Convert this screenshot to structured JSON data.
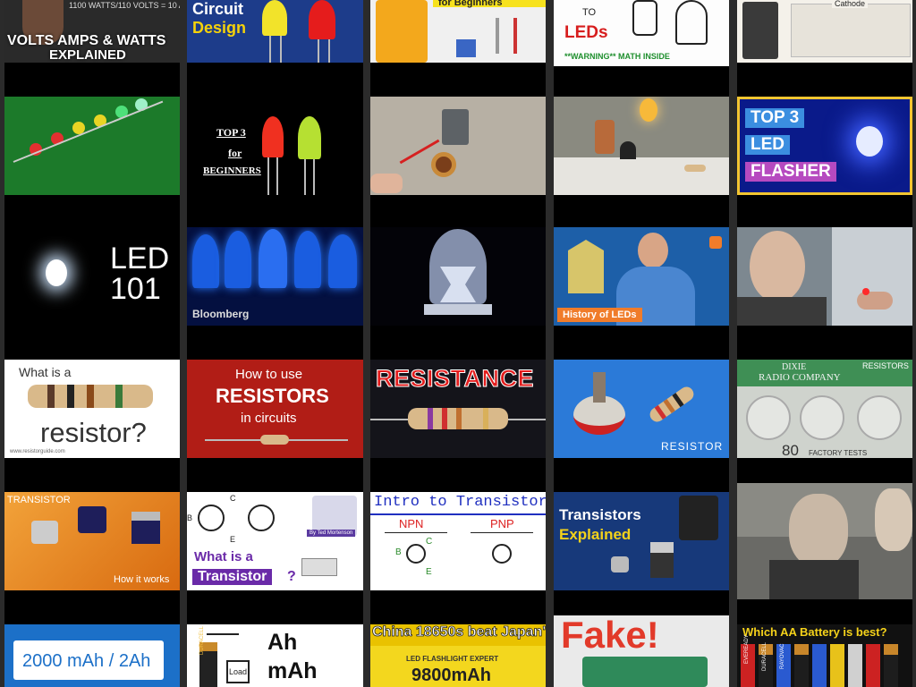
{
  "grid": {
    "row1": {
      "c1": {
        "line1": "1100 WATTS/110 VOLTS = 10 AMPS",
        "line2": "VOLTS AMPS & WATTS",
        "line3": "EXPLAINED"
      },
      "c2": {
        "line1": "Circuit",
        "line2": "Design"
      },
      "c3": {
        "line1": "for Beginners"
      },
      "c4": {
        "line1": "TO",
        "line2": "LEDs",
        "line3": "**WARNING** MATH INSIDE"
      },
      "c5": {
        "line1": "Cathode"
      }
    },
    "row2": {
      "c2": {
        "line1": "TOP 3",
        "line2": "for",
        "line3": "BEGINNERS"
      },
      "c5": {
        "line1": "TOP 3",
        "line2": "LED",
        "line3": "FLASHER"
      }
    },
    "row3": {
      "c1": {
        "line1": "LED",
        "line2": "101"
      },
      "c2": {
        "line1": "Bloomberg"
      },
      "c4": {
        "line1": "History of LEDs"
      }
    },
    "row4": {
      "c1": {
        "line1": "What is a",
        "line2": "resistor?",
        "line3": "www.resistorguide.com"
      },
      "c2": {
        "line1": "How to use",
        "line2": "RESISTORS",
        "line3": "in circuits"
      },
      "c3": {
        "line1": "RESISTANCE"
      },
      "c4": {
        "line1": "RESISTOR"
      },
      "c5": {
        "line1": "DIXIE",
        "line2": "RADIO COMPANY",
        "line3": "RESISTORS",
        "line4": "80",
        "line5": "FACTORY TESTS"
      }
    },
    "row5": {
      "c1": {
        "line1": "TRANSISTOR",
        "line2": "How it works"
      },
      "c2": {
        "line1": "What is a",
        "line2": "Transistor",
        "line3": "?",
        "line4": "By Ted Mortenson",
        "pinC": "C",
        "pinB": "B",
        "pinE": "E"
      },
      "c3": {
        "line1": "Intro to Transistors",
        "npn": "NPN",
        "pnp": "PNP",
        "pinC": "C",
        "pinB": "B",
        "pinE": "E"
      },
      "c4": {
        "line1": "Transistors",
        "line2": "Explained"
      }
    },
    "row6": {
      "c1": {
        "line1": "2000 mAh / 2Ah"
      },
      "c2": {
        "line1": "Ah",
        "line2": "mAh",
        "line3": "Load",
        "line4": "DURACELL"
      },
      "c3": {
        "line1": "China 18650s beat Japan's?",
        "line2": "LED FLASHLIGHT EXPERT",
        "line3": "9800mAh"
      },
      "c4": {
        "line1": "Fake!"
      },
      "c5": {
        "line1": "Which AA Battery is best?",
        "b1": "EVEREADY",
        "b2": "DURACELL",
        "b3": "RAYOVAC"
      }
    }
  }
}
